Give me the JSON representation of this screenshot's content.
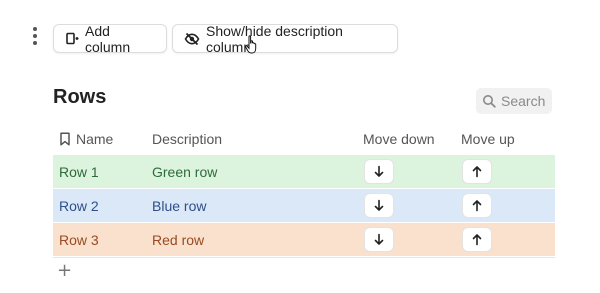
{
  "toolbar": {
    "add_column_label": "Add column",
    "toggle_description_label": "Show/hide description column"
  },
  "table": {
    "title": "Rows",
    "search_placeholder": "Search",
    "columns": {
      "name": "Name",
      "description": "Description",
      "move_down": "Move down",
      "move_up": "Move up"
    },
    "rows": [
      {
        "name": "Row 1",
        "description": "Green row",
        "color": "#dcf3de"
      },
      {
        "name": "Row 2",
        "description": "Blue row",
        "color": "#dbe8f8"
      },
      {
        "name": "Row 3",
        "description": "Red row",
        "color": "#f9e1cd"
      }
    ],
    "add_row_glyph": "+"
  },
  "icons": {
    "menu": "vertical-dots-icon",
    "add_column": "add-column-icon",
    "toggle": "eye-slash-icon",
    "search": "search-icon",
    "name_column": "bookmark-icon",
    "move_down": "arrow-down-icon",
    "move_up": "arrow-up-icon",
    "cursor": "hand-pointer-icon"
  }
}
